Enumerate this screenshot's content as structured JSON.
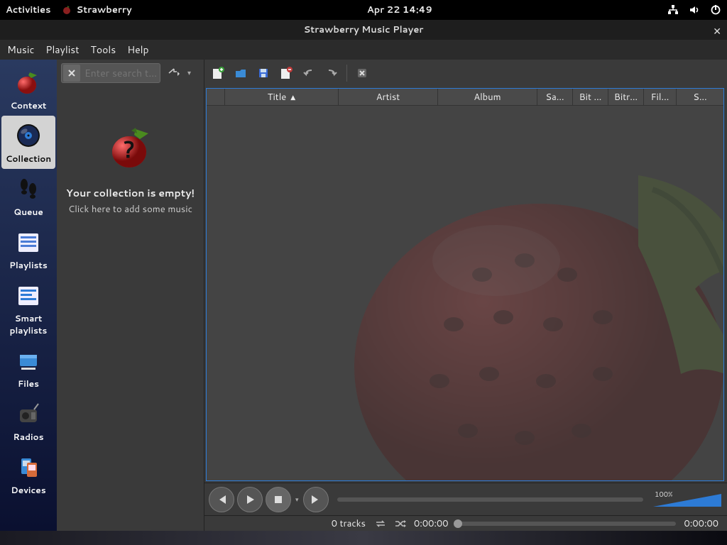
{
  "topbar": {
    "activities": "Activities",
    "appname": "Strawberry",
    "clock": "Apr 22  14:49"
  },
  "window": {
    "title": "Strawberry Music Player"
  },
  "menubar": {
    "music": "Music",
    "playlist": "Playlist",
    "tools": "Tools",
    "help": "Help"
  },
  "rail": {
    "context": "Context",
    "collection": "Collection",
    "queue": "Queue",
    "playlists": "Playlists",
    "smart1": "Smart",
    "smart2": "playlists",
    "files": "Files",
    "radios": "Radios",
    "devices": "Devices"
  },
  "search": {
    "placeholder": "Enter search t…"
  },
  "empty": {
    "line1": "Your collection is empty!",
    "line2": "Click here to add some music"
  },
  "columns": {
    "title": "Title",
    "artist": "Artist",
    "album": "Album",
    "sample": "Sa…",
    "bitdepth": "Bit …",
    "bitrate": "Bitr…",
    "filename": "Fil…",
    "source": "S…"
  },
  "volume": {
    "label": "100%"
  },
  "status": {
    "tracks": "0 tracks",
    "time_left": "0:00:00",
    "time_right": "0:00:00"
  }
}
